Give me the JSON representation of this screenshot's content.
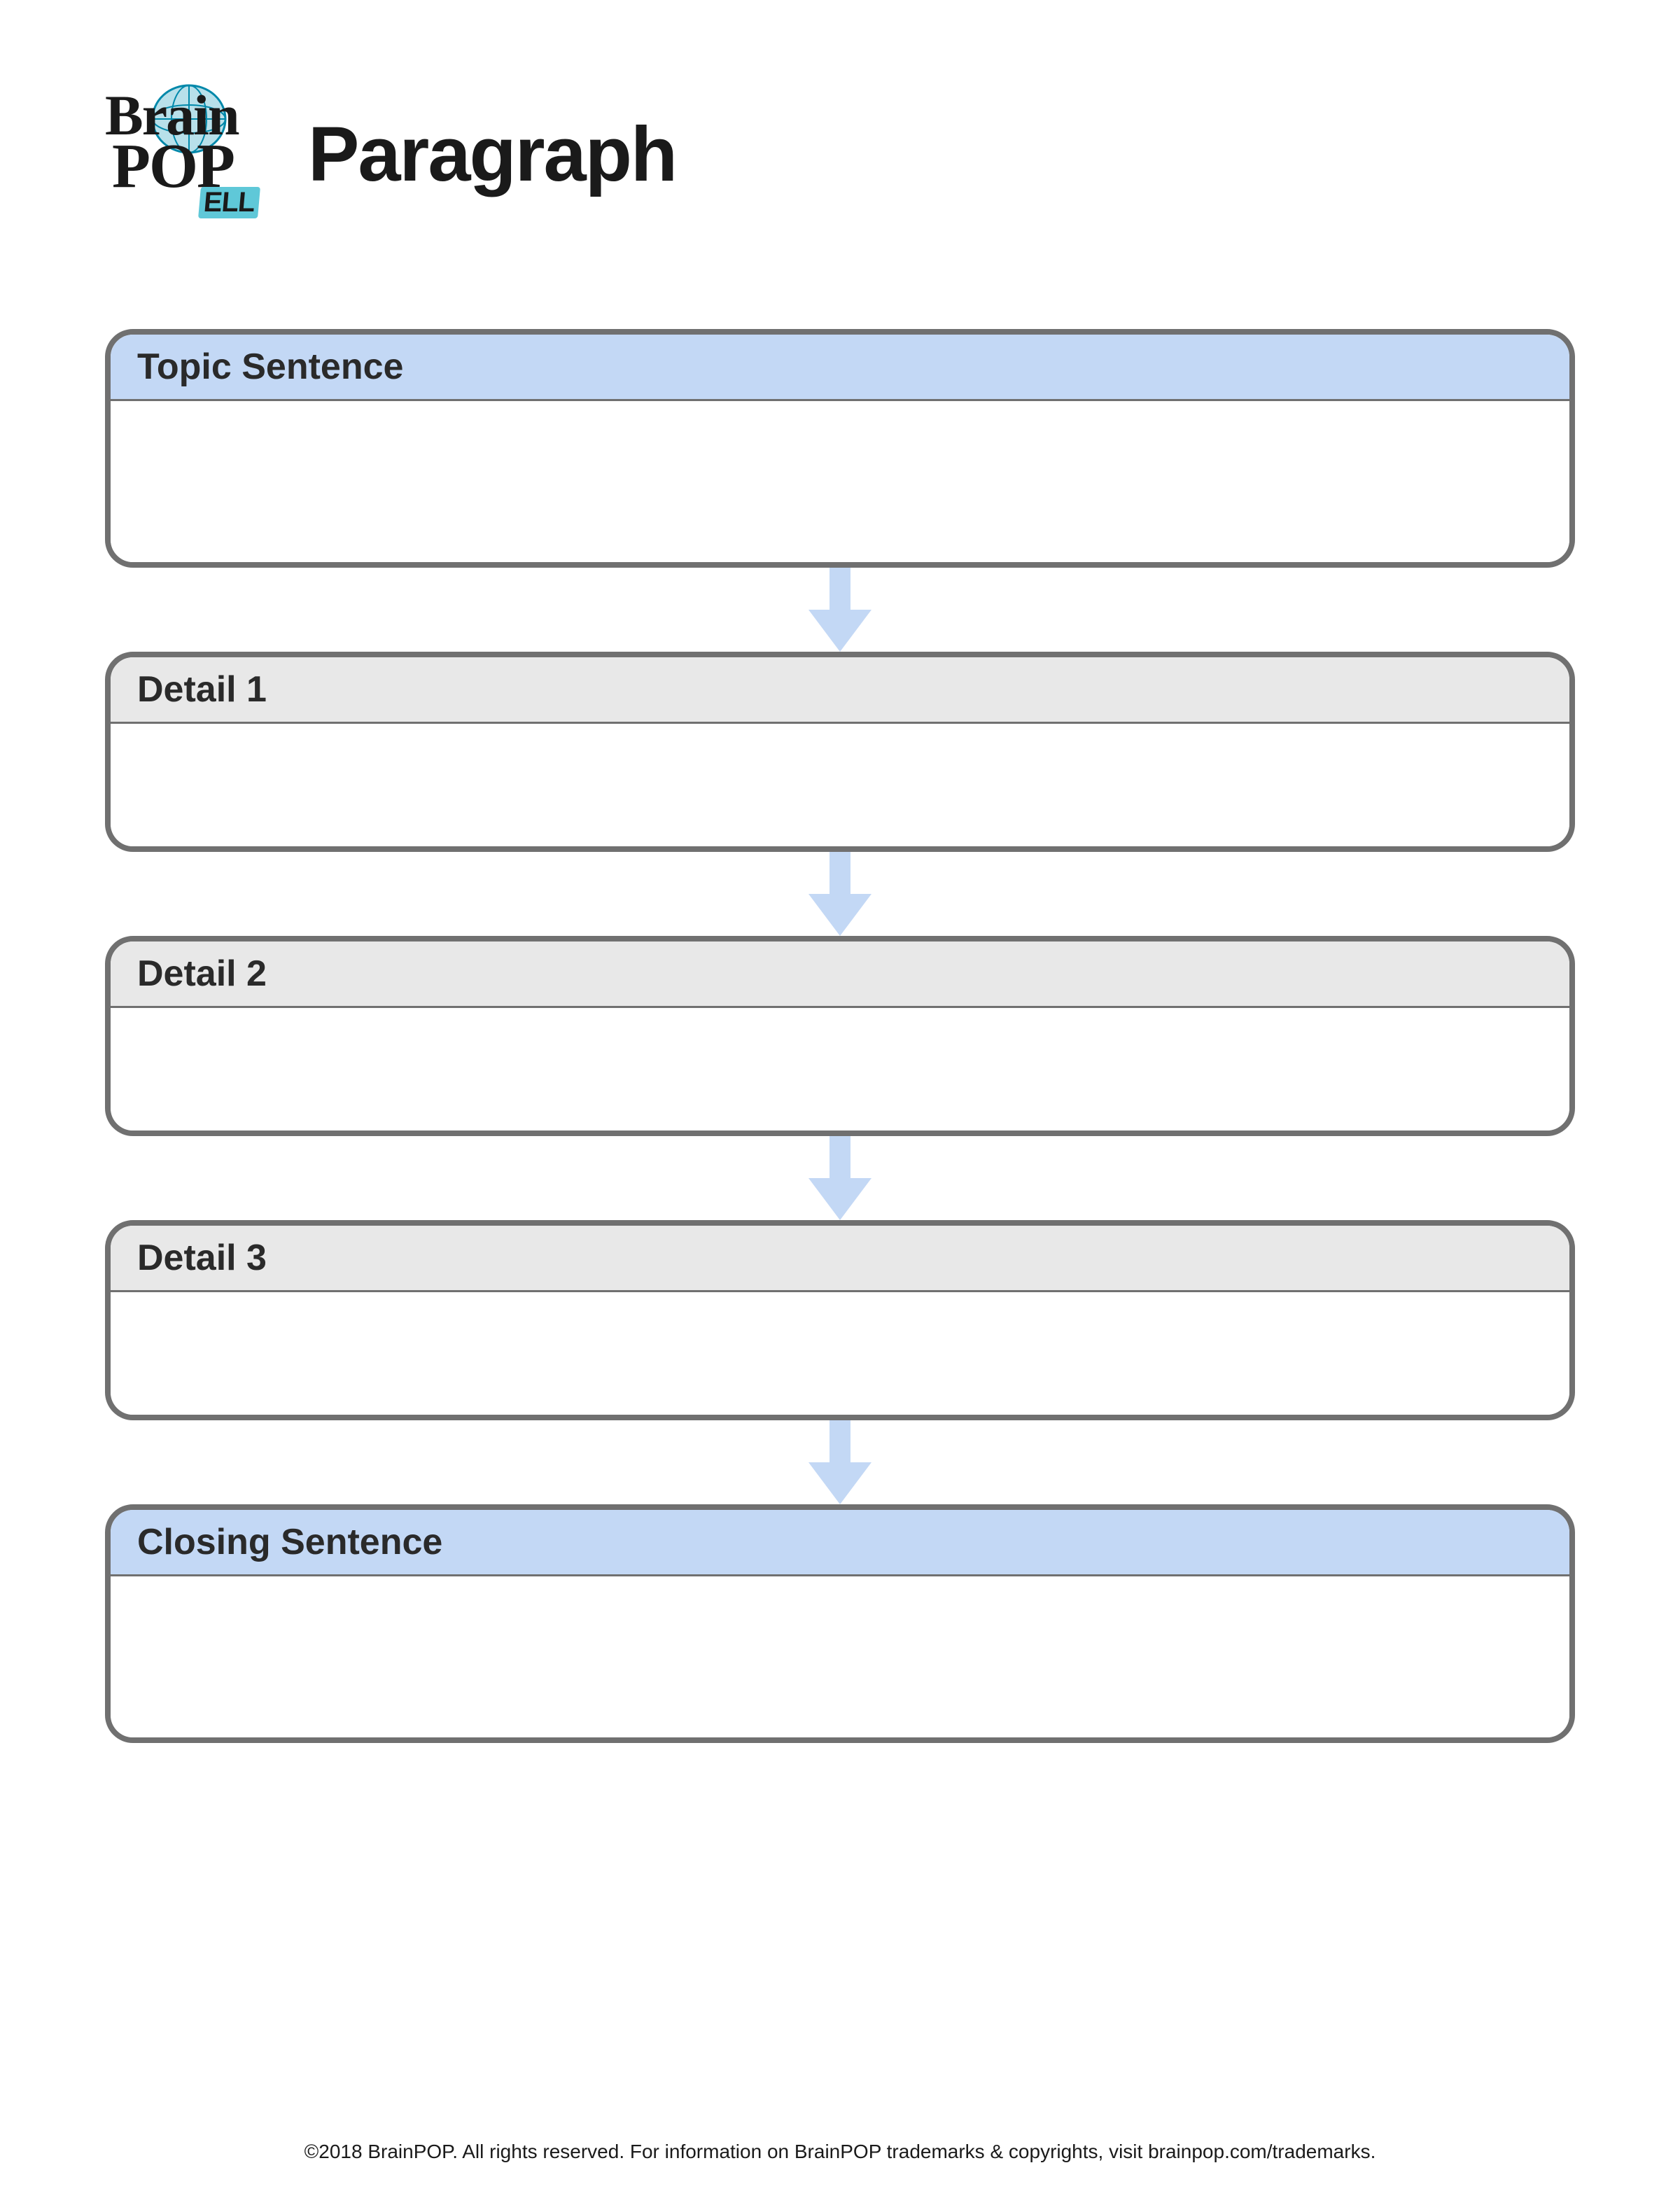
{
  "logo": {
    "brain": "Brain",
    "pop": "POP",
    "ell": "ELL"
  },
  "title": "Paragraph",
  "sections": [
    {
      "label": "Topic Sentence",
      "header_color": "blue",
      "size": "large"
    },
    {
      "label": "Detail 1",
      "header_color": "gray",
      "size": "normal"
    },
    {
      "label": "Detail 2",
      "header_color": "gray",
      "size": "normal"
    },
    {
      "label": "Detail 3",
      "header_color": "gray",
      "size": "normal"
    },
    {
      "label": "Closing Sentence",
      "header_color": "blue",
      "size": "large"
    }
  ],
  "colors": {
    "arrow_fill": "#c3d8f5",
    "header_blue": "#c3d8f5",
    "header_gray": "#e8e8e8",
    "border": "#707070"
  },
  "footer": "©2018 BrainPOP. All rights reserved. For information on BrainPOP trademarks & copyrights, visit brainpop.com/trademarks."
}
